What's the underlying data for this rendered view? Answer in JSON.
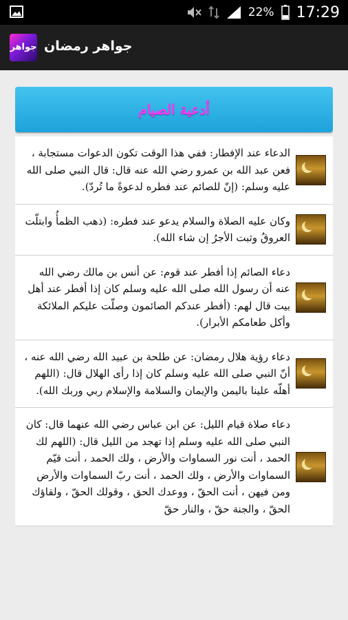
{
  "status_bar": {
    "battery_percent": "22%",
    "time": "17:29"
  },
  "app_bar": {
    "logo_text": "جواهر",
    "title": "جواهر رمضان"
  },
  "header": {
    "title": "أدعية الصيام"
  },
  "items": [
    {
      "text": "الدعاء عند الإفطار: ففي هذا الوقت تكون الدعوات مستجابة ، فعن عبد الله بن عمرو رضي الله عنه قال: قال النبي صلى الله عليه وسلم: (إنّ للصائم عند فطره لدعوةً ما تُردّ)."
    },
    {
      "text": "وكان عليه الصلاة والسلام يدعو عند فطره: (ذهب الظمأُ وابتلّت العروقُ وثبت الأجرُ إن شاء الله)."
    },
    {
      "text": "دعاء الصائم إذا أفطر عند قوم: عن أنس بن مالك رضي الله عنه أن رسول الله صلى الله عليه وسلم كان إذا أفطر عند أهل بيت قال لهم: (أفطر عندكم الصائمون وصلّت عليكم الملائكة وأكل طعامكم الأبرار)."
    },
    {
      "text": "دعاء رؤية هلال رمضان: عن طلحة بن عبيد الله رضي الله عنه ، أنّ النبي صلى الله عليه وسلم كان إذا رأى الهلال قال: (اللهم أهلّه علينا باليمن والإيمان والسلامة والإسلام ربي وربك الله)."
    },
    {
      "text": "دعاء صلاة قيام الليل: عن ابن عباس رضي الله عنهما قال: كان النبي صلى الله عليه وسلم إذا تهجد من الليل قال: (اللهم لك الحمد ، أنت نور السماوات والأرض ، ولك الحمد ، أنت قيّم السماوات والأرض ، ولك الحمد ، أنت ربّ السماوات والأرض ومن فيهن ، أنت الحقّ ، ووعدك الحق ، وقولك الحقّ ، ولقاؤك الحقّ ، والجنة حقّ ، والنار حقّ"
    }
  ]
}
